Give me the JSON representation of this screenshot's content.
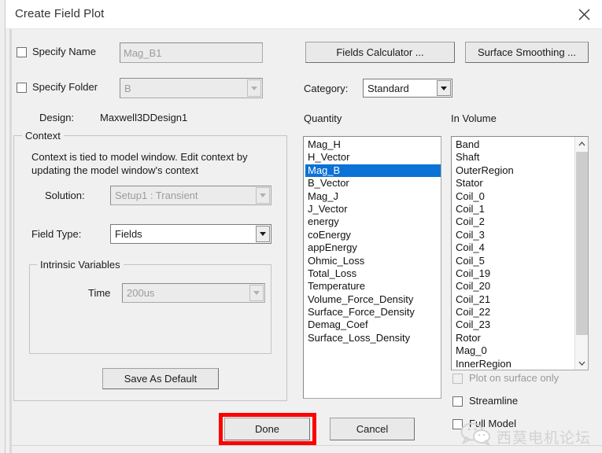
{
  "window": {
    "title": "Create Field Plot",
    "close_icon": "close-icon"
  },
  "left_panel": {
    "specify_name": {
      "label": "Specify Name",
      "checked": false,
      "value": "Mag_B1",
      "enabled": false
    },
    "specify_folder": {
      "label": "Specify Folder",
      "checked": false,
      "value": "B",
      "enabled": false
    },
    "design": {
      "label": "Design:",
      "value": "Maxwell3DDesign1"
    },
    "context": {
      "title": "Context",
      "description_line1": "Context is tied to model window. Edit context by",
      "description_line2": "updating the model window's context",
      "solution": {
        "label": "Solution:",
        "value": "Setup1 : Transient",
        "enabled": false
      },
      "field_type": {
        "label": "Field Type:",
        "value": "Fields",
        "enabled": true
      },
      "intrinsic_variables": {
        "title": "Intrinsic Variables",
        "time": {
          "label": "Time",
          "value": "200us",
          "enabled": false
        }
      },
      "save_as_default_label": "Save As Default"
    }
  },
  "right_panel": {
    "fields_calculator_label": "Fields Calculator ...",
    "surface_smoothing_label": "Surface Smoothing ...",
    "category": {
      "label": "Category:",
      "value": "Standard"
    },
    "quantity": {
      "header": "Quantity",
      "selected": "Mag_B",
      "items": [
        "Mag_H",
        "H_Vector",
        "Mag_B",
        "B_Vector",
        "Mag_J",
        "J_Vector",
        "energy",
        "coEnergy",
        "appEnergy",
        "Ohmic_Loss",
        "Total_Loss",
        "Temperature",
        "Volume_Force_Density",
        "Surface_Force_Density",
        "Demag_Coef",
        "Surface_Loss_Density"
      ]
    },
    "in_volume": {
      "header": "In Volume",
      "items": [
        "Band",
        "Shaft",
        "OuterRegion",
        "Stator",
        "Coil_0",
        "Coil_1",
        "Coil_2",
        "Coil_3",
        "Coil_4",
        "Coil_5",
        "Coil_19",
        "Coil_20",
        "Coil_21",
        "Coil_22",
        "Coil_23",
        "Rotor",
        "Mag_0",
        "InnerRegion"
      ]
    },
    "options": [
      {
        "label": "Plot on surface only",
        "checked": false,
        "enabled": false
      },
      {
        "label": "Streamline",
        "checked": false,
        "enabled": true
      },
      {
        "label": "Full Model",
        "checked": false,
        "enabled": true
      }
    ]
  },
  "footer": {
    "done_label": "Done",
    "cancel_label": "Cancel",
    "highlight_color": "#fe0000"
  },
  "watermark": {
    "text": "西莫电机论坛"
  }
}
